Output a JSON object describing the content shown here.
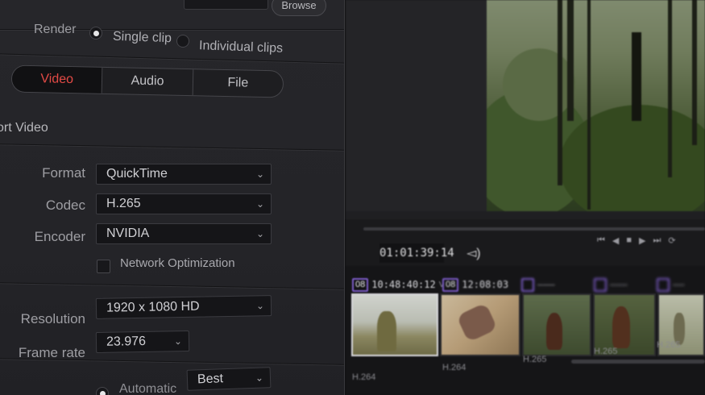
{
  "render_settings": {
    "browse_label": "Browse",
    "render_label": "Render",
    "render_options": [
      {
        "label": "Single clip",
        "selected": true
      },
      {
        "label": "Individual clips",
        "selected": false
      }
    ],
    "tabs": [
      {
        "label": "Video",
        "active": true
      },
      {
        "label": "Audio",
        "active": false
      },
      {
        "label": "File",
        "active": false
      }
    ],
    "section_title": "ort Video",
    "fields": {
      "format": {
        "label": "Format",
        "value": "QuickTime"
      },
      "codec": {
        "label": "Codec",
        "value": "H.265"
      },
      "encoder": {
        "label": "Encoder",
        "value": "NVIDIA"
      },
      "network_optimization": {
        "label": "Network Optimization",
        "checked": false
      },
      "resolution": {
        "label": "Resolution",
        "value": "1920 x 1080 HD"
      },
      "frame_rate": {
        "label": "Frame rate",
        "value": "23.976"
      },
      "quality": {
        "label": "Automatic",
        "value": "Best"
      }
    },
    "colors": {
      "active_tab_text": "#e24a45",
      "panel_bg": "#242428"
    }
  },
  "viewer": {
    "timecode": "01:01:39:14",
    "clips": [
      {
        "track": "08",
        "timecode": "10:48:40:12",
        "track_label": "V1",
        "codec": "H.264"
      },
      {
        "track": "08",
        "timecode": "12:08:03",
        "codec": "H.264"
      },
      {
        "codec": "H.265"
      },
      {
        "codec": "H.265"
      },
      {
        "codec": "H.265"
      }
    ],
    "colors": {
      "badge_border": "#7c5cc8"
    }
  },
  "icons": {
    "radio": "radio-button",
    "dropdown": "chevron-down-icon",
    "speaker": "speaker-icon"
  }
}
